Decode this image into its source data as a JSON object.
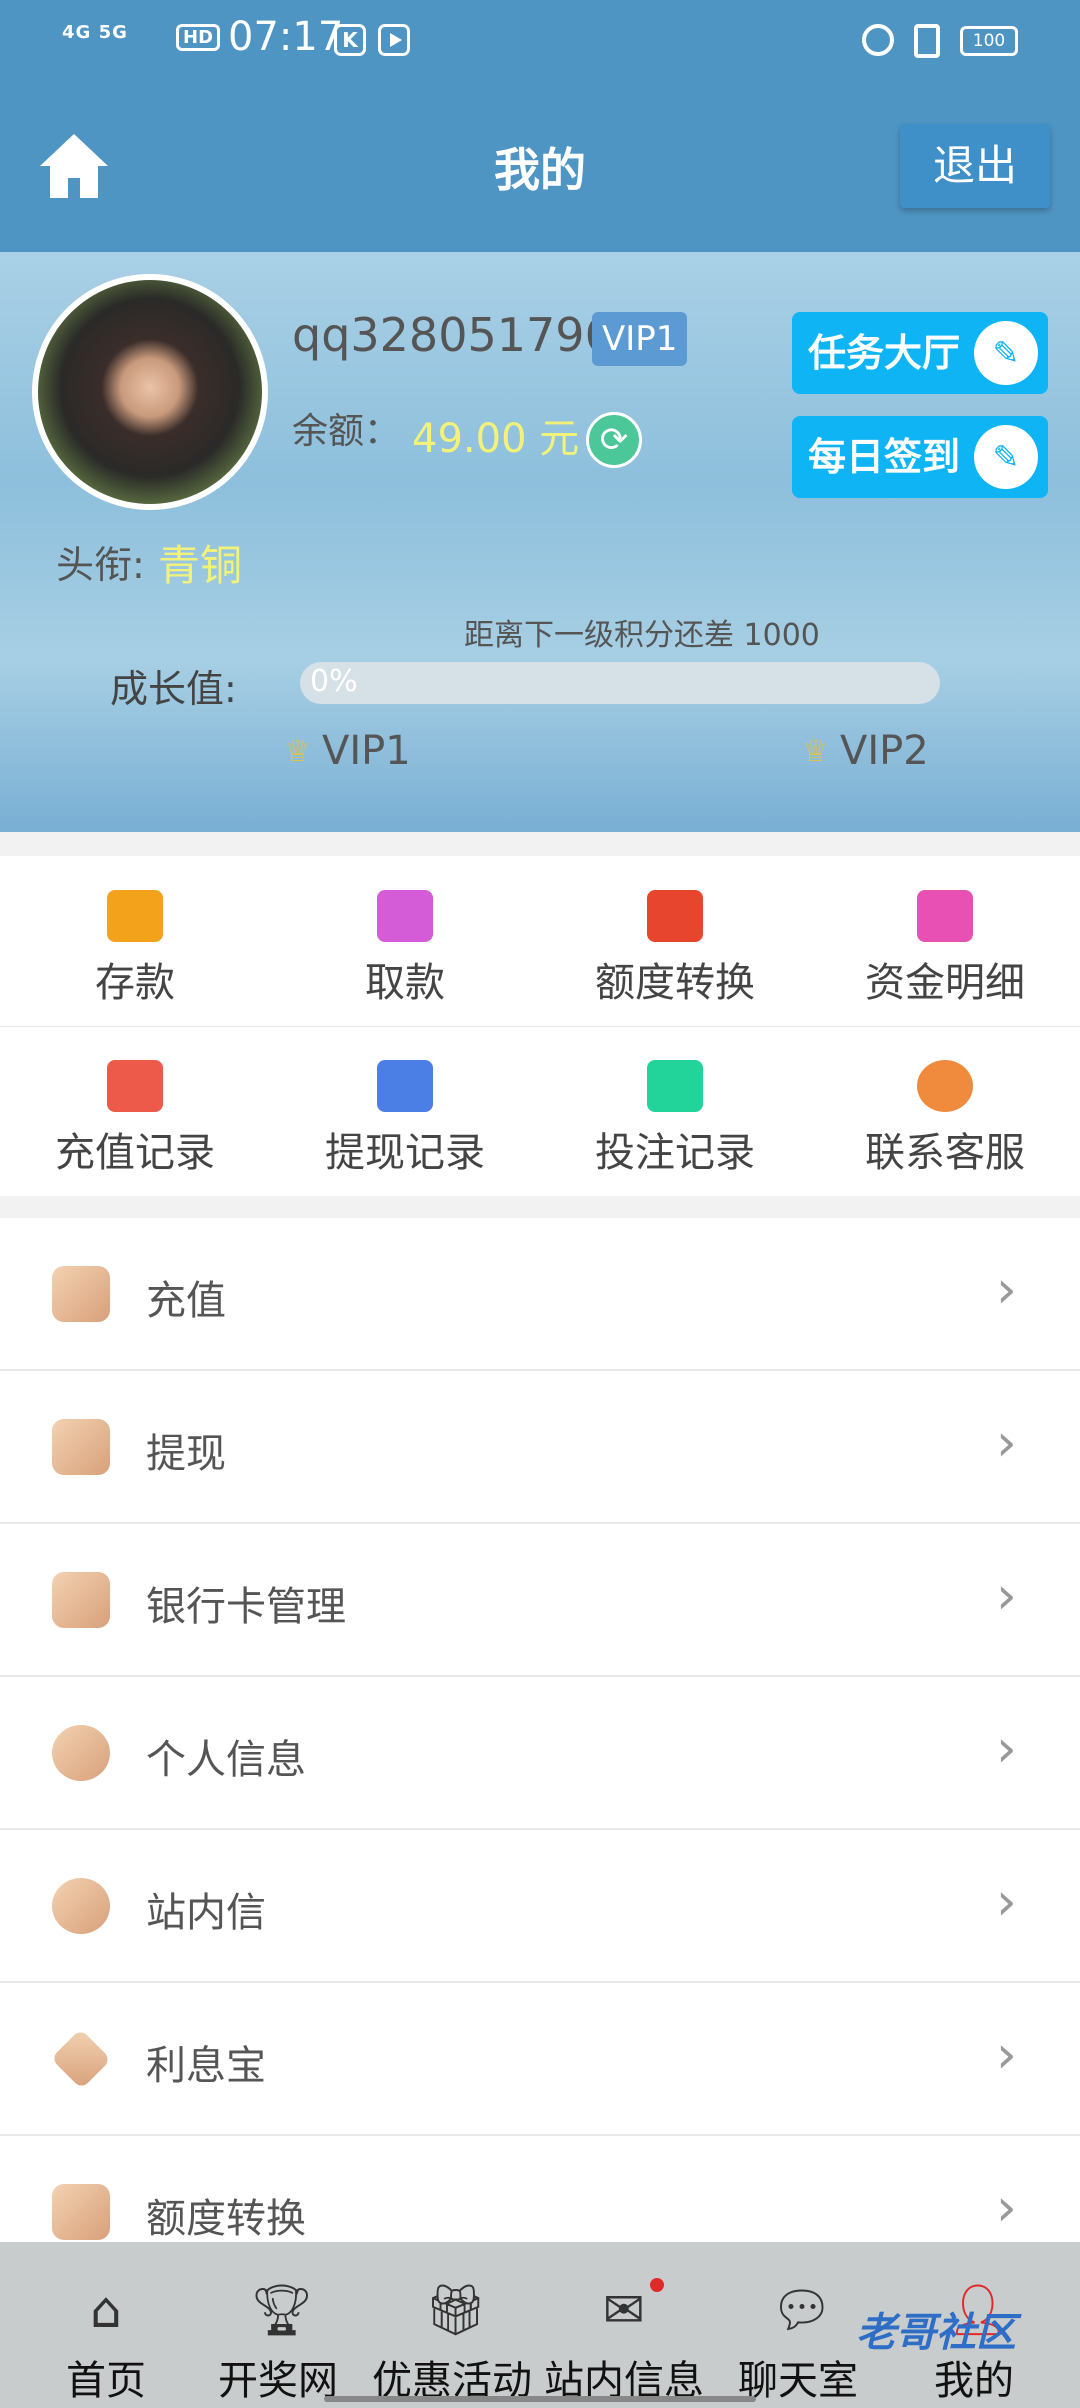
{
  "status_bar": {
    "network": "4G 5G",
    "hd": "HD",
    "time": "07:17",
    "k_icon": "K",
    "battery": "100"
  },
  "header": {
    "title": "我的",
    "logout": "退出"
  },
  "profile": {
    "username": "qq328051796",
    "vip_badge": "VIP1",
    "balance_label": "余额：",
    "balance_value": "49.00 元",
    "task_hall": "任务大厅",
    "daily_sign": "每日签到",
    "title_label": "头衔:",
    "title_value": "青铜",
    "next_level_text": "距离下一级积分还差 1000",
    "growth_label": "成长值:",
    "progress_text": "0%",
    "progress_fraction": 0,
    "vip_current": "VIP1",
    "vip_next": "VIP2"
  },
  "grid": {
    "items": [
      {
        "label": "存款",
        "color": "#f3a21c"
      },
      {
        "label": "取款",
        "color": "#d45cd6"
      },
      {
        "label": "额度转换",
        "color": "#e8452e"
      },
      {
        "label": "资金明细",
        "color": "#e850b4"
      },
      {
        "label": "充值记录",
        "color": "#ee5a4a"
      },
      {
        "label": "提现记录",
        "color": "#4c7fe6"
      },
      {
        "label": "投注记录",
        "color": "#22d39a"
      },
      {
        "label": "联系客服",
        "color": "#f08a3c"
      }
    ]
  },
  "list": {
    "items": [
      {
        "label": "充值"
      },
      {
        "label": "提现"
      },
      {
        "label": "银行卡管理"
      },
      {
        "label": "个人信息"
      },
      {
        "label": "站内信"
      },
      {
        "label": "利息宝"
      },
      {
        "label": "额度转换"
      }
    ]
  },
  "bottom_nav": {
    "items": [
      {
        "label": "首页"
      },
      {
        "label": "开奖网"
      },
      {
        "label": "优惠活动"
      },
      {
        "label": "站内信息"
      },
      {
        "label": "聊天室"
      },
      {
        "label": "我的"
      }
    ]
  },
  "watermark": "老哥社区",
  "colors": {
    "header": "#4f95c4",
    "accent_button": "#0fb4f4",
    "highlight": "#f2f27a",
    "active_nav": "#e02a2a"
  }
}
